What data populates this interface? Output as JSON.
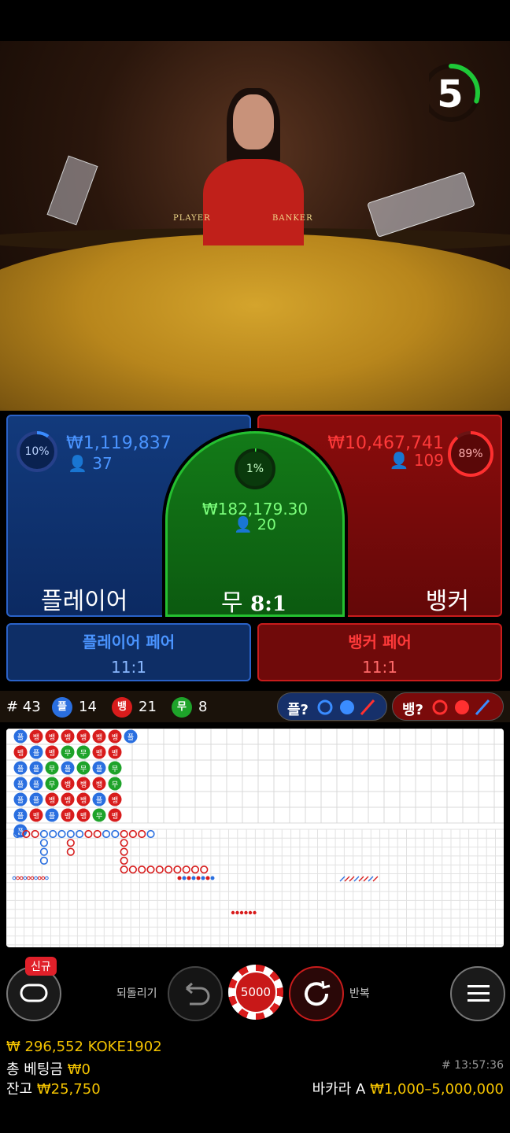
{
  "timer": {
    "value": "5",
    "progress": 0.3
  },
  "table_labels": {
    "player": "PLAYER",
    "banker": "BANKER"
  },
  "player": {
    "pct": "10%",
    "amount": "₩1,119,837",
    "users": "37",
    "label": "플레이어",
    "fill": 0.1
  },
  "banker": {
    "pct": "89%",
    "amount": "₩10,467,741",
    "users": "109",
    "label": "뱅커",
    "fill": 0.89
  },
  "tie": {
    "pct": "1%",
    "amount": "₩182,179.30",
    "users": "20",
    "label": "무",
    "odds": "8:1",
    "fill": 0.01
  },
  "player_pair": {
    "label": "플레이어 페어",
    "odds": "11:1"
  },
  "banker_pair": {
    "label": "뱅커 페어",
    "odds": "11:1"
  },
  "stats": {
    "round": "# 43",
    "player_badge": "플",
    "player_count": "14",
    "banker_badge": "뱅",
    "banker_count": "21",
    "tie_badge": "무",
    "tie_count": "8",
    "player_ask": "플?",
    "banker_ask": "뱅?"
  },
  "colors": {
    "player": "#2a6fe0",
    "banker": "#d81c1c",
    "tie": "#1ea32a",
    "gold": "#f5c400"
  },
  "bead_road": [
    [
      "플",
      "뱅",
      "플",
      "플",
      "플",
      "플",
      "플"
    ],
    [
      "뱅",
      "플",
      "플",
      "플",
      "플",
      "뱅"
    ],
    [
      "뱅",
      "뱅",
      "무",
      "무",
      "뱅",
      "플"
    ],
    [
      "뱅",
      "무",
      "플",
      "뱅",
      "뱅",
      "뱅"
    ],
    [
      "뱅",
      "무",
      "무",
      "뱅",
      "뱅",
      "뱅"
    ],
    [
      "뱅",
      "뱅",
      "플",
      "뱅",
      "플",
      "무"
    ],
    [
      "뱅",
      "뱅",
      "무",
      "무",
      "뱅",
      "뱅"
    ],
    [
      "플"
    ]
  ],
  "controls": {
    "new_badge": "신규",
    "undo_label": "되돌리기",
    "chip_value": "5000",
    "repeat_label": "반복"
  },
  "footer": {
    "balance_line": "₩ 296,552 KOKE1902",
    "total_bet_label": "총 베팅금",
    "total_bet_value": "₩0",
    "balance_label": "잔고",
    "balance_value": "₩25,750",
    "time": "# 13:57:36",
    "table_name": "바카라 A",
    "limits": "₩1,000–5,000,000"
  }
}
